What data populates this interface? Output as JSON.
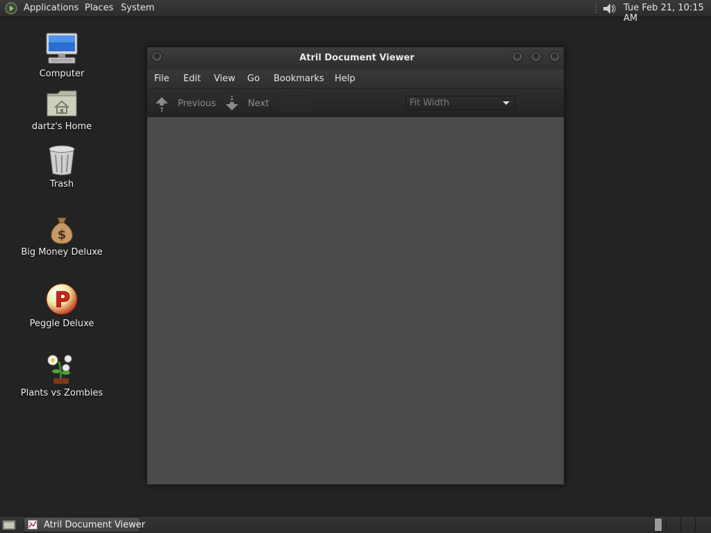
{
  "top_panel": {
    "menus": [
      "Applications",
      "Places",
      "System"
    ],
    "clock": "Tue Feb 21, 10:15 AM",
    "icons": [
      "gnome-foot-icon",
      "volume-icon"
    ]
  },
  "desktop": {
    "icons": [
      {
        "label": "Computer",
        "icon": "computer-icon"
      },
      {
        "label": "dartz's Home",
        "icon": "home-folder-icon"
      },
      {
        "label": "Trash",
        "icon": "trash-icon"
      },
      {
        "label": "Big Money Deluxe",
        "icon": "money-bag-icon"
      },
      {
        "label": "Peggle Deluxe",
        "icon": "peggle-icon"
      },
      {
        "label": "Plants vs Zombies",
        "icon": "plants-vs-zombies-icon"
      }
    ]
  },
  "window": {
    "title": "Atril Document Viewer",
    "menus": [
      "File",
      "Edit",
      "View",
      "Go",
      "Bookmarks",
      "Help"
    ],
    "toolbar": {
      "previous_label": "Previous",
      "next_label": "Next",
      "page_value": "",
      "zoom_value": "Fit Width"
    }
  },
  "bottom_panel": {
    "task_label": "Atril Document Viewer"
  },
  "colors": {
    "desktop_bg": "#232323",
    "panel_bg": "#2f2f2f",
    "window_bg": "#4a4a4a",
    "text_dim": "#8d8d8d"
  }
}
